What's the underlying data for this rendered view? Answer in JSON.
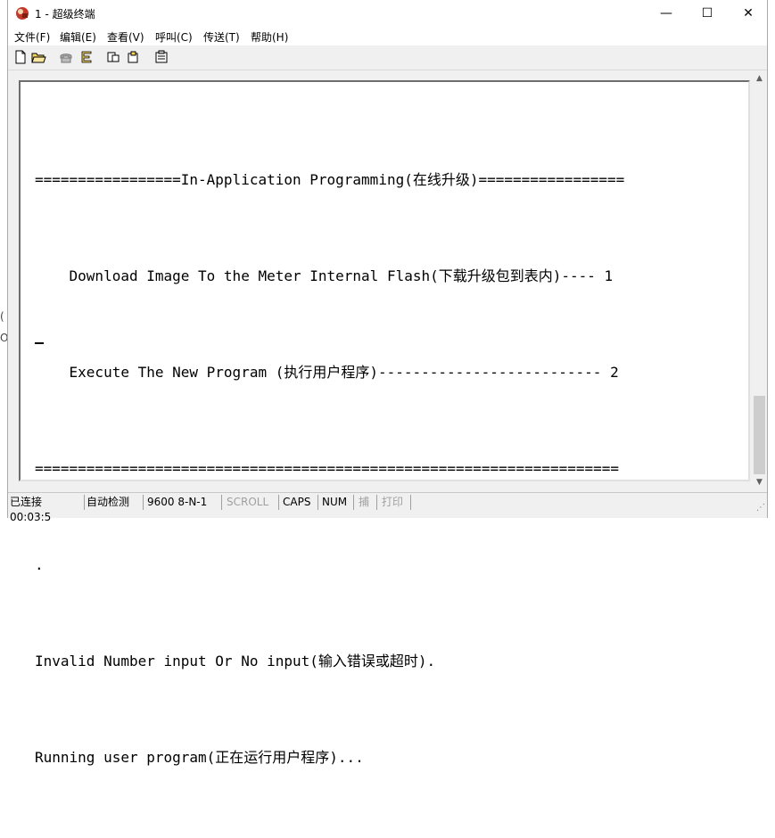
{
  "window": {
    "title": "1 - 超级终端",
    "controls": {
      "minimize": "—",
      "maximize": "☐",
      "close": "✕"
    }
  },
  "menu": [
    {
      "label": "文件(F)"
    },
    {
      "label": "编辑(E)"
    },
    {
      "label": "查看(V)"
    },
    {
      "label": "呼叫(C)"
    },
    {
      "label": "传送(T)"
    },
    {
      "label": "帮助(H)"
    }
  ],
  "toolbar": {
    "icons": [
      "new-file-icon",
      "open-folder-icon",
      "phone-icon",
      "disconnect-icon",
      "send-icon",
      "receive-icon",
      "properties-icon"
    ]
  },
  "terminal": {
    "lines": [
      "=================In-Application Programming(在线升级)=================",
      "    Download Image To the Meter Internal Flash(下载升级包到表内)---- 1",
      "    Execute The New Program (执行用户程序)-------------------------- 2",
      "====================================================================",
      ".",
      "Invalid Number input Or No input(输入错误或超时).",
      "Running user program(正在运行用户程序)..."
    ]
  },
  "status": {
    "connected": "已连接 00:03:5",
    "detect": "自动检测",
    "baud": "9600 8-N-1",
    "scroll": "SCROLL",
    "caps": "CAPS",
    "num": "NUM",
    "capture": "捕",
    "print": "打印"
  },
  "left_fragments": [
    "(",
    "O"
  ]
}
